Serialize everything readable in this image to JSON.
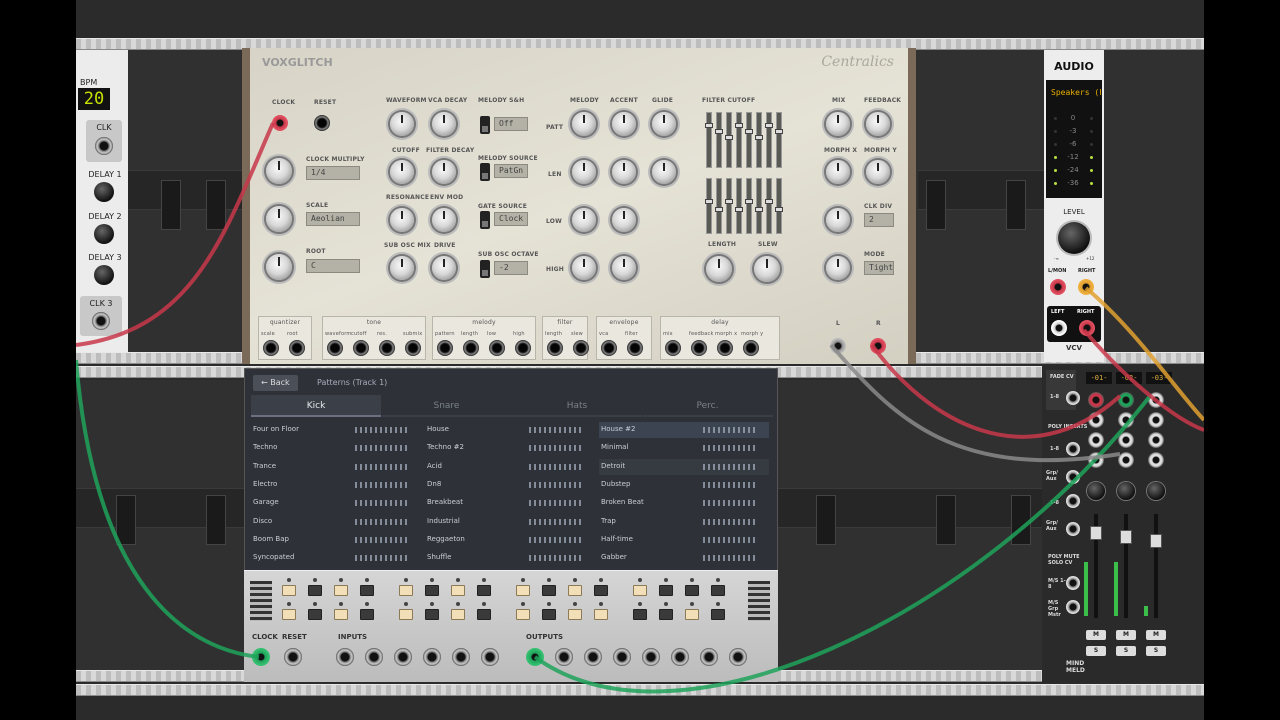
{
  "clock_module": {
    "bpm_label": "BPM",
    "bpm_value": "20",
    "clk_label": "CLK",
    "delay1": "DELAY 1",
    "delay2": "DELAY 2",
    "delay3": "DELAY 3",
    "clk3": "CLK 3"
  },
  "centralics": {
    "brand": "VOXGLITCH",
    "name": "Centralics",
    "labels": {
      "clock": "CLOCK",
      "reset": "RESET",
      "clock_multiply": "CLOCK MULTIPLY",
      "scale": "SCALE",
      "root": "ROOT",
      "waveform": "WAVEFORM",
      "vca_decay": "VCA DECAY",
      "cutoff": "CUTOFF",
      "filter_decay": "FILTER DECAY",
      "resonance": "RESONANCE",
      "env_mod": "ENV MOD",
      "sub_osc_mix": "SUB OSC MIX",
      "drive": "DRIVE",
      "melody_sh": "MELODY S&H",
      "melody_source": "MELODY SOURCE",
      "gate_source": "GATE SOURCE",
      "sub_osc_octave": "SUB OSC OCTAVE",
      "melody": "MELODY",
      "accent": "ACCENT",
      "glide": "GLIDE",
      "patt": "PATT",
      "len": "LEN",
      "low": "LOW",
      "high": "HIGH",
      "filter_cutoff": "FILTER CUTOFF",
      "length": "LENGTH",
      "slew": "SLEW",
      "mix": "MIX",
      "feedback": "FEEDBACK",
      "morph_x": "MORPH X",
      "morph_y": "MORPH Y",
      "clk_div": "CLK DIV",
      "mode": "MODE",
      "l": "L",
      "r": "R"
    },
    "values": {
      "clock_multiply": "1/4",
      "scale": "Aeolian",
      "root": "C",
      "melody_sh": "Off",
      "melody_source": "PatGn",
      "gate_source": "Clock",
      "sub_osc_octave": "-2",
      "clk_div": "2",
      "mode": "Tight"
    },
    "cv_groups": [
      {
        "title": "quantizer",
        "items": [
          "scale",
          "root"
        ]
      },
      {
        "title": "tone",
        "items": [
          "waveform",
          "cutoff",
          "res.",
          "submix"
        ]
      },
      {
        "title": "melody",
        "items": [
          "pattern",
          "length",
          "low",
          "high"
        ]
      },
      {
        "title": "filter",
        "items": [
          "length",
          "slew"
        ]
      },
      {
        "title": "envelope",
        "items": [
          "vca",
          "filter"
        ]
      },
      {
        "title": "delay",
        "items": [
          "mix",
          "feedback",
          "morph x",
          "morph y"
        ]
      }
    ]
  },
  "patterns": {
    "back": "← Back",
    "title": "Patterns (Track 1)",
    "tabs": [
      "Kick",
      "Snare",
      "Hats",
      "Perc."
    ],
    "col1": [
      "Four on Floor",
      "Techno",
      "Trance",
      "Electro",
      "Garage",
      "Disco",
      "Boom Bap",
      "Syncopated"
    ],
    "col2": [
      "House",
      "Techno #2",
      "Acid",
      "Dn8",
      "Breakbeat",
      "Industrial",
      "Reggaeton",
      "Shuffle"
    ],
    "col3": [
      "House #2",
      "Minimal",
      "Detroit",
      "Dubstep",
      "Broken Beat",
      "Trap",
      "Half-time",
      "Gabber"
    ],
    "io": {
      "clock": "CLOCK",
      "reset": "RESET",
      "inputs": "INPUTS",
      "outputs": "OUTPUTS"
    }
  },
  "audio": {
    "header": "AUDIO",
    "device": "Speakers (Fo",
    "meter": [
      "0",
      "-3",
      "-6",
      "-12",
      "-24",
      "-36"
    ],
    "level": "LEVEL",
    "min": "-∞",
    "max": "+12",
    "lmon": "L/MON",
    "right": "RIGHT",
    "left": "LEFT",
    "right2": "RIGHT",
    "logo": "VCV"
  },
  "mixer": {
    "fade_cv": "FADE CV",
    "fade_range": "1-8",
    "poly_inserts": "POLY INSERTS",
    "ins1": "1-8",
    "grp_aux": "Grp/ Aux",
    "ins2": "1-8",
    "grp_aux2": "Grp/ Aux",
    "poly_mute": "POLY MUTE SOLO CV",
    "ms18": "M/S 1-8",
    "ms_grp": "M/S Grp Mstr",
    "tracks": [
      "-01-",
      "-02-",
      "-03-"
    ],
    "m": "M",
    "s": "S",
    "brand": "MIND MELD"
  }
}
